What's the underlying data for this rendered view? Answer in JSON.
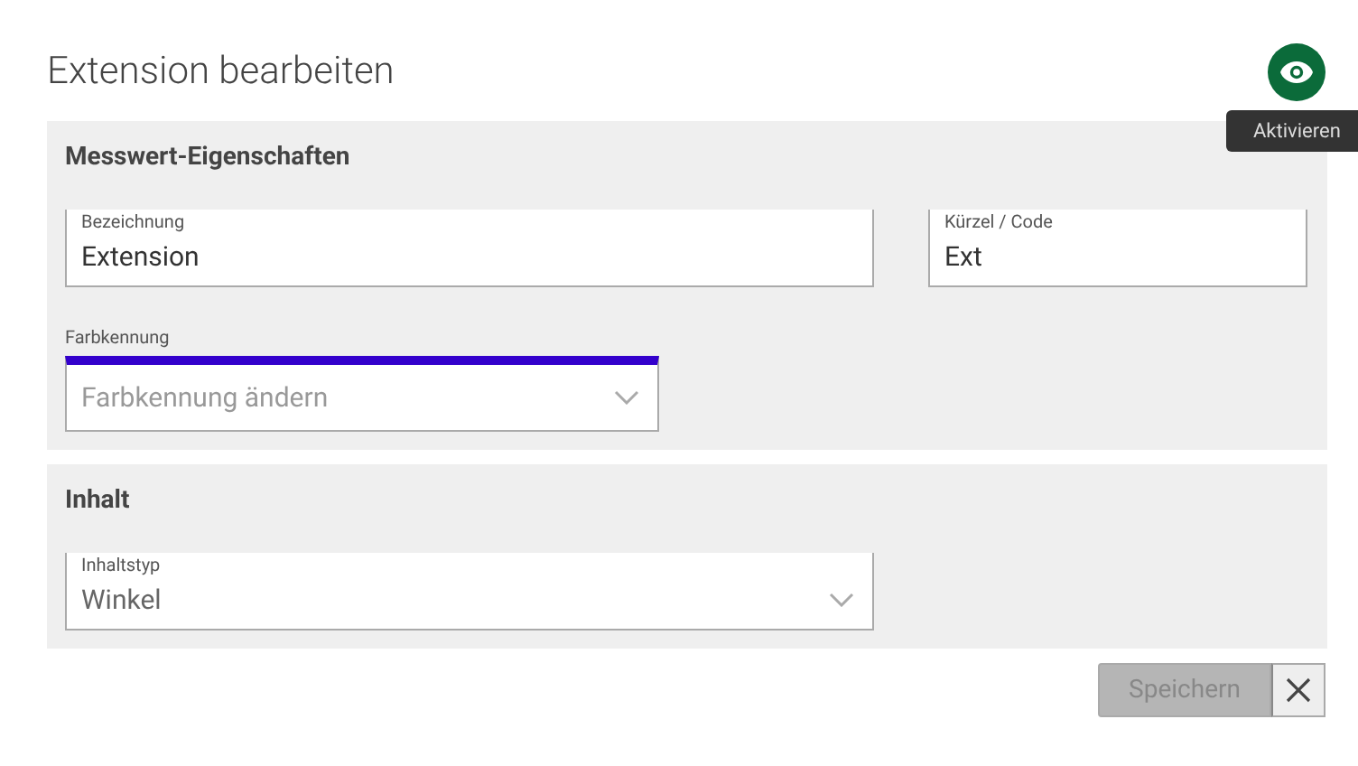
{
  "title": "Extension bearbeiten",
  "activate_button": {
    "tooltip": "Aktivieren"
  },
  "sections": [
    {
      "title": "Messwert-Eigenschaften",
      "rows": [
        [
          {
            "kind": "text",
            "label": "Bezeichnung",
            "value": "Extension"
          },
          {
            "kind": "text",
            "label": "Kürzel / Code",
            "value": "Ext"
          }
        ],
        [
          {
            "kind": "color-select",
            "label": "Farbkennung",
            "placeholder": "Farbkennung ändern",
            "color": "#3300cc"
          }
        ]
      ]
    },
    {
      "title": "Inhalt",
      "rows": [
        [
          {
            "kind": "select",
            "label": "Inhaltstyp",
            "value": "Winkel"
          }
        ]
      ]
    }
  ],
  "save_button": {
    "label": "Speichern",
    "disabled": true
  }
}
